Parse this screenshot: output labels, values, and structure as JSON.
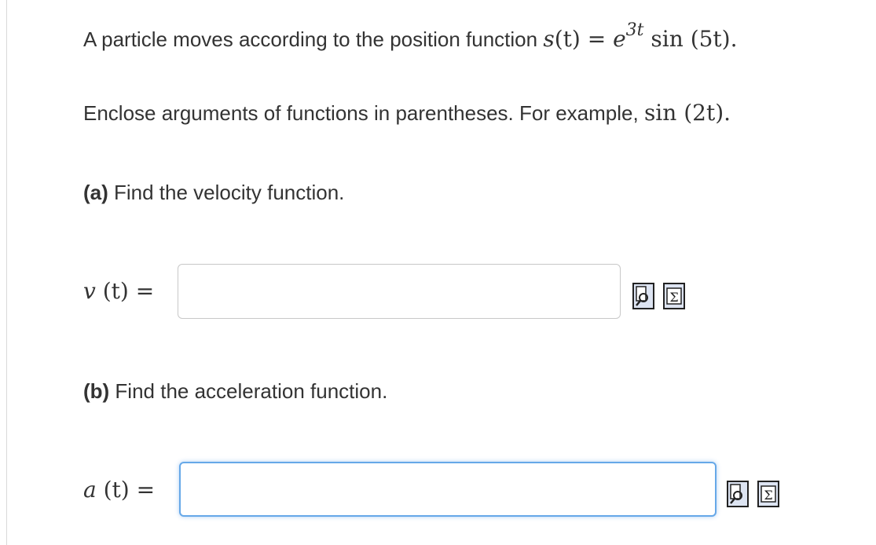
{
  "intro": {
    "text": "A particle moves according to the position function ",
    "formula": {
      "lhs": "s",
      "arg": "(t)",
      "eq": " = ",
      "base": "e",
      "exp": "3t",
      "func": " sin ",
      "func_arg": "(5t)",
      "period": "."
    }
  },
  "instruction": {
    "text": "Enclose arguments of functions in parentheses. For example, ",
    "example_func": "sin ",
    "example_arg": "(2t)",
    "period": "."
  },
  "part_a": {
    "tag": "(a)",
    "question": " Find the velocity function.",
    "label_var": "v",
    "label_arg": " (t)",
    "label_eq": " = ",
    "input_value": ""
  },
  "part_b": {
    "tag": "(b)",
    "question": " Find the acceleration function.",
    "label_var": "a",
    "label_arg": " (t)",
    "label_eq": " = ",
    "input_value": ""
  },
  "icons": [
    "preview-icon",
    "sigma-equation-editor-icon"
  ]
}
